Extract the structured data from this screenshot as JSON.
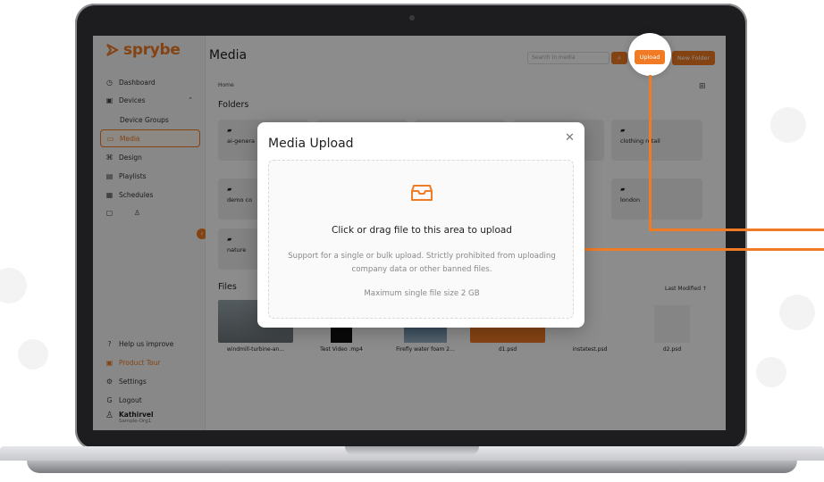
{
  "brand": {
    "name": "sprybe",
    "accent": "#f07b24"
  },
  "sidebar": {
    "items": [
      {
        "label": "Dashboard",
        "icon": "clock-icon"
      },
      {
        "label": "Devices",
        "icon": "devices-icon"
      },
      {
        "label": "Device Groups",
        "icon": ""
      },
      {
        "label": "Media",
        "icon": "image-icon"
      },
      {
        "label": "Design",
        "icon": "design-icon"
      },
      {
        "label": "Playlists",
        "icon": "playlist-icon"
      },
      {
        "label": "Schedules",
        "icon": "calendar-icon"
      }
    ],
    "bottom_items": [
      {
        "label": "Help us improve",
        "icon": "help-icon"
      },
      {
        "label": "Product Tour",
        "icon": "tour-icon"
      },
      {
        "label": "Settings",
        "icon": "gear-icon"
      },
      {
        "label": "Logout",
        "icon": "logout-icon"
      }
    ],
    "user": {
      "name": "Kathirvel",
      "org": "Sample-Org1"
    }
  },
  "header": {
    "title": "Media",
    "search_placeholder": "Search in media",
    "upload_label": "Upload",
    "new_folder_label": "New Folder"
  },
  "breadcrumb": "Home",
  "folders_title": "Folders",
  "folders": [
    "ai-genera",
    "clothing retail",
    "demo co",
    "london",
    "nature"
  ],
  "files_title": "Files",
  "sort_label": "Last Modified ↑",
  "files": [
    {
      "name": "windmill-turbine-an..."
    },
    {
      "name": "Test Video .mp4"
    },
    {
      "name": "Firefly water foam 2..."
    },
    {
      "name": "d1.psd"
    },
    {
      "name": "instatest.psd"
    },
    {
      "name": "d2.psd"
    }
  ],
  "modal": {
    "title": "Media Upload",
    "main_text": "Click or drag file to this area to upload",
    "hint_text": "Support for a single or bulk upload. Strictly prohibited from uploading company data or other banned files.",
    "max_text": "Maximum single file size 2 GB"
  }
}
